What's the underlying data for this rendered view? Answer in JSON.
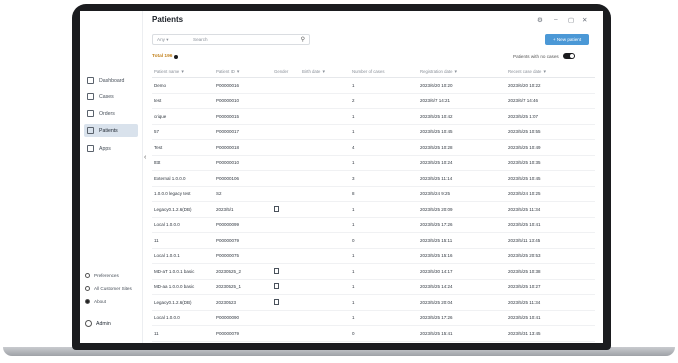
{
  "window": {
    "title": "Patients",
    "controls": [
      "⚙",
      "–",
      "▢",
      "✕"
    ]
  },
  "sidebar": {
    "items": [
      {
        "label": "Dashboard",
        "icon": "dashboard-icon",
        "active": false
      },
      {
        "label": "Cases",
        "icon": "cases-icon",
        "active": false
      },
      {
        "label": "Orders",
        "icon": "orders-icon",
        "active": false
      },
      {
        "label": "Patients",
        "icon": "patients-icon",
        "active": true
      },
      {
        "label": "Apps",
        "icon": "apps-icon",
        "active": false
      }
    ],
    "footer": {
      "preferences": "Preferences",
      "customer": "All Customer Sites",
      "about": "About",
      "admin": "Admin"
    }
  },
  "toolbar": {
    "filter": "Any",
    "search_placeholder": "Search",
    "new_button": "+ New patient"
  },
  "summary": {
    "total": "Total 196",
    "toggle_label": "Patients with no cases"
  },
  "table": {
    "headers": [
      "Patient name ▼",
      "Patient ID ▼",
      "Gender",
      "Birth date ▼",
      "Number of cases",
      "Registration date ▼",
      "Recent case date ▼"
    ],
    "rows": [
      [
        "Demo",
        "P00000016",
        "",
        "",
        "1",
        "2023/6/20 10:20",
        "2023/6/20 10:22"
      ],
      [
        "test",
        "P00000010",
        "",
        "",
        "2",
        "2023/6/7 14:21",
        "2023/6/7 14:46"
      ],
      [
        "crique",
        "P00000015",
        "",
        "",
        "1",
        "2023/5/25 10:42",
        "2023/5/25 1:07"
      ],
      [
        "57",
        "P00000017",
        "",
        "",
        "1",
        "2023/5/25 10:45",
        "2023/5/25 10:55"
      ],
      [
        "Test",
        "P00000018",
        "",
        "",
        "4",
        "2023/5/25 10:28",
        "2023/5/25 10:49"
      ],
      [
        "ttttt",
        "P00000010",
        "",
        "",
        "1",
        "2023/5/25 10:24",
        "2023/5/25 10:35"
      ],
      [
        "External 1.0.0.0",
        "P00000106",
        "",
        "",
        "3",
        "2023/5/25 11:14",
        "2023/5/25 10:45"
      ],
      [
        "1.0.0.0 legacy test",
        "S2",
        "",
        "",
        "8",
        "2023/5/24 9:25",
        "2023/5/24 10:25"
      ],
      [
        "Legacy0.1.2.6(DB)",
        "2023/5/1",
        "icon",
        "",
        "1",
        "2023/5/25 20:09",
        "2023/5/25 11:34"
      ],
      [
        "Local 1.0.0.0",
        "P00000099",
        "",
        "",
        "1",
        "2023/5/25 17:26",
        "2023/5/25 10:41"
      ],
      [
        "11",
        "P00000079",
        "",
        "",
        "0",
        "2023/5/25 15:11",
        "2023/5/11 13:45"
      ],
      [
        "Local 1.0.0.1",
        "P00000075",
        "",
        "",
        "1",
        "2023/5/25 15:16",
        "2023/5/25 20:53"
      ],
      [
        "MD-aT 1.0.0.1 basic",
        "20230525_2",
        "icon",
        "",
        "1",
        "2023/5/30 14:17",
        "2023/5/25 10:38"
      ],
      [
        "MD-aa 1.0.0.0 basic",
        "20230525_1",
        "icon",
        "",
        "1",
        "2023/5/25 14:24",
        "2023/5/25 10:27"
      ],
      [
        "Legacy0.1.2.6(DB)",
        "20230523",
        "icon",
        "",
        "1",
        "2023/5/25 20:04",
        "2023/5/25 11:34"
      ],
      [
        "Local 1.0.0.0",
        "P00000090",
        "",
        "",
        "1",
        "2023/5/25 17:26",
        "2023/5/25 10:41"
      ],
      [
        "11",
        "P00000079",
        "",
        "",
        "0",
        "2023/5/25 15:41",
        "2023/5/31 13:45"
      ],
      [
        "Local 1.0.0.1",
        "P00000076",
        "",
        "",
        "1",
        "2023/5/25 15:18",
        "2023/5/25 20:53"
      ]
    ]
  },
  "colors": {
    "accent": "#4b98d6",
    "active_nav": "#d9e2ec",
    "total": "#c2821e"
  }
}
